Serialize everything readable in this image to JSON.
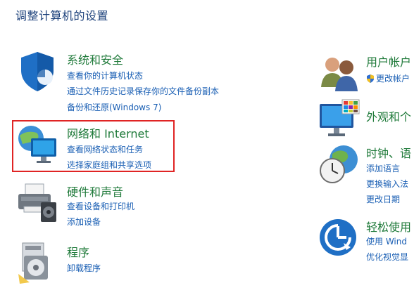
{
  "page_title": "调整计算机的设置",
  "categories": [
    {
      "title": "系统和安全",
      "links": [
        "查看你的计算机状态",
        "通过文件历史记录保存你的文件备份副本",
        "备份和还原(Windows 7)"
      ]
    },
    {
      "title": "网络和 Internet",
      "links": [
        "查看网络状态和任务",
        "选择家庭组和共享选项"
      ]
    },
    {
      "title": "硬件和声音",
      "links": [
        "查看设备和打印机",
        "添加设备"
      ]
    },
    {
      "title": "程序",
      "links": [
        "卸载程序"
      ]
    }
  ],
  "right_categories": [
    {
      "title": "用户帐户",
      "links": [
        "更改帐户"
      ]
    },
    {
      "title": "外观和个",
      "links": []
    },
    {
      "title": "时钟、语",
      "links": [
        "添加语言",
        "更换输入法",
        "更改日期"
      ]
    },
    {
      "title": "轻松使用",
      "links": [
        "使用 Wind",
        "优化视觉显"
      ]
    }
  ],
  "colors": {
    "category_title": "#1f7a3a",
    "link": "#1a5fb4",
    "highlight": "#e02424",
    "page_title": "#1a3f7a"
  }
}
